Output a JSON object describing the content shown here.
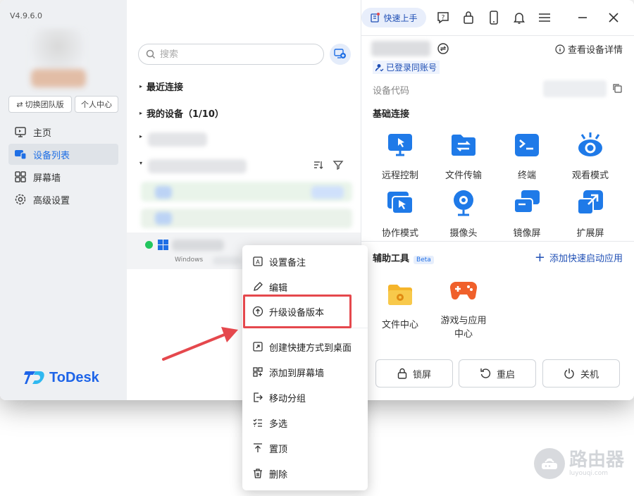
{
  "app": {
    "version": "V4.9.6.0",
    "brand": "ToDesk",
    "accent": "#1f6fe5"
  },
  "sidebar": {
    "switch_team_label": "切换团队版",
    "personal_center_label": "个人中心",
    "items": [
      {
        "label": "主页",
        "icon": "monitor-icon"
      },
      {
        "label": "设备列表",
        "icon": "devices-icon",
        "active": true
      },
      {
        "label": "屏幕墙",
        "icon": "grid-icon"
      },
      {
        "label": "高级设置",
        "icon": "gear-icon"
      }
    ]
  },
  "header": {
    "quick_start_label": "快速上手"
  },
  "device_list": {
    "search_placeholder": "搜索",
    "groups": {
      "recent": "最近连接",
      "mine": "我的设备（1/10）"
    },
    "selected_device": {
      "os": "Windows",
      "status": "online"
    }
  },
  "details": {
    "view_details_label": "查看设备详情",
    "account_tag": "已登录同账号",
    "code_label": "设备代码",
    "basic_title": "基础连接",
    "basic_tools": [
      {
        "label": "远程控制",
        "icon": "remote-control-icon"
      },
      {
        "label": "文件传输",
        "icon": "file-transfer-icon"
      },
      {
        "label": "终端",
        "icon": "terminal-icon"
      },
      {
        "label": "观看模式",
        "icon": "eye-icon"
      },
      {
        "label": "协作模式",
        "icon": "collab-icon"
      },
      {
        "label": "摄像头",
        "icon": "camera-icon"
      },
      {
        "label": "镜像屏",
        "icon": "mirror-screen-icon"
      },
      {
        "label": "扩展屏",
        "icon": "extend-screen-icon"
      }
    ],
    "aux_title": "辅助工具",
    "beta_label": "Beta",
    "add_app_label": "添加快速启动应用",
    "aux_tools": [
      {
        "label": "文件中心",
        "icon": "folder-icon"
      },
      {
        "label": "游戏与应用\n中心",
        "label_line1": "游戏与应用",
        "label_line2": "中心",
        "icon": "gamepad-icon"
      }
    ],
    "actions": {
      "lock": "锁屏",
      "restart": "重启",
      "shutdown": "关机"
    }
  },
  "context_menu": {
    "items": [
      {
        "label": "设置备注",
        "icon": "note-icon"
      },
      {
        "label": "编辑",
        "icon": "pencil-icon"
      },
      {
        "label": "升级设备版本",
        "icon": "upgrade-icon",
        "highlighted": true
      },
      {
        "label": "创建快捷方式到桌面",
        "icon": "shortcut-icon"
      },
      {
        "label": "添加到屏幕墙",
        "icon": "add-wall-icon"
      },
      {
        "label": "移动分组",
        "icon": "move-icon"
      },
      {
        "label": "多选",
        "icon": "multiselect-icon"
      },
      {
        "label": "置顶",
        "icon": "pin-top-icon"
      },
      {
        "label": "删除",
        "icon": "trash-icon"
      }
    ]
  },
  "watermark": {
    "title": "路由器",
    "subtitle": "luyouqi.com"
  }
}
